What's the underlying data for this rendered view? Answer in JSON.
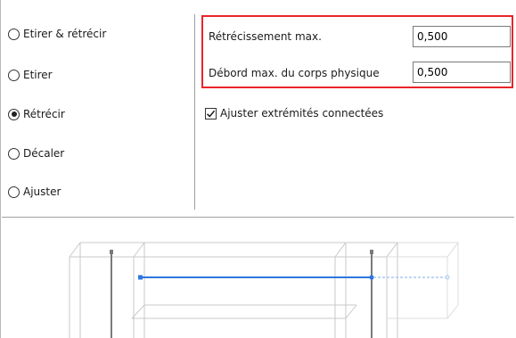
{
  "options": [
    {
      "label": "Etirer & rétrécir",
      "checked": false
    },
    {
      "label": "Etirer",
      "checked": false
    },
    {
      "label": "Rétrécir",
      "checked": true
    },
    {
      "label": "Décaler",
      "checked": false
    },
    {
      "label": "Ajuster",
      "checked": false
    }
  ],
  "params": {
    "max_shrink_label": "Rétrécissement max.",
    "max_shrink_value": "0,500",
    "max_overhang_label": "Débord max. du corps physique",
    "max_overhang_value": "0,500"
  },
  "adjust_ends": {
    "label": "Ajuster extrémités connectées",
    "checked": true
  },
  "colors": {
    "highlight": "#e8252b",
    "accent": "#2f76e0",
    "accent_faded": "#a9c8f2"
  }
}
